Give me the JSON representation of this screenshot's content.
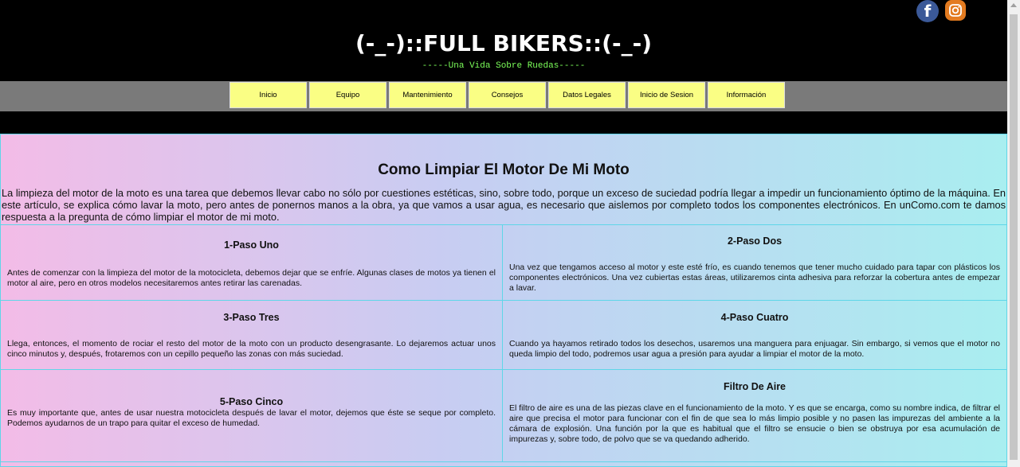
{
  "header": {
    "title": "(-_-)::FULL BIKERS::(-_-)",
    "subtitle": "-----Una Vida Sobre Ruedas-----",
    "social": [
      {
        "icon": "facebook-icon",
        "glyph": "f"
      },
      {
        "icon": "instagram-icon"
      }
    ]
  },
  "nav": {
    "items": [
      "Inicio",
      "Equipo",
      "Mantenimiento",
      "Consejos",
      "Datos Legales",
      "Inicio de Sesion",
      "Información"
    ]
  },
  "main": {
    "title": "Como Limpiar El Motor De Mi Moto",
    "intro": "La limpieza del motor de la moto es una tarea que debemos llevar cabo no sólo por cuestiones estéticas, sino, sobre todo, porque un exceso de suciedad podría llegar a impedir un funcionamiento óptimo de la máquina. En este artículo, se explica cómo lavar la moto, pero antes de ponernos manos a la obra, ya que vamos a usar agua, es necesario que aislemos por completo todos los componentes electrónicos. En unComo.com te damos respuesta a la pregunta de cómo limpiar el motor de mi moto.",
    "steps": [
      {
        "title": "1-Paso Uno",
        "text": "Antes de comenzar con la limpieza del motor de la motocicleta, debemos dejar que se enfríe. Algunas clases de motos ya tienen el motor al aire, pero en otros modelos necesitaremos antes retirar las carenadas."
      },
      {
        "title": "2-Paso Dos",
        "text": "Una vez que tengamos acceso al motor y este esté frío, es cuando tenemos que tener mucho cuidado para tapar con plásticos los componentes electrónicos. Una vez cubiertas estas áreas, utilizaremos cinta adhesiva para reforzar la cobertura antes de empezar a lavar."
      },
      {
        "title": "3-Paso Tres",
        "text": "Llega, entonces, el momento de rociar el resto del motor de la moto con un producto desengrasante. Lo dejaremos actuar unos cinco minutos y, después, frotaremos con un cepillo pequeño las zonas con más suciedad."
      },
      {
        "title": "4-Paso Cuatro",
        "text": "Cuando ya hayamos retirado todos los desechos, usaremos una manguera para enjuagar. Sin embargo, si vemos que el motor no queda limpio del todo, podremos usar agua a presión para ayudar a limpiar el motor de la moto."
      },
      {
        "title": "5-Paso Cinco",
        "text": "Es muy importante que, antes de usar nuestra motocicleta después de lavar el motor, dejemos que éste se seque por completo. Podemos ayudarnos de un trapo para quitar el exceso de humedad."
      },
      {
        "title": "Filtro De Aire",
        "text": "El filtro de aire es una de las piezas clave en el funcionamiento de la moto. Y es que se encarga, como su nombre indica, de filtrar el aire que precisa el motor para funcionar con el fin de que sea lo más limpio posible y no pasen las impurezas del ambiente a la cámara de explosión. Una función por la que es habitual que el filtro se ensucie o bien se obstruya por esa acumulación de impurezas y, sobre todo, de polvo que se va quedando adherido."
      }
    ]
  }
}
